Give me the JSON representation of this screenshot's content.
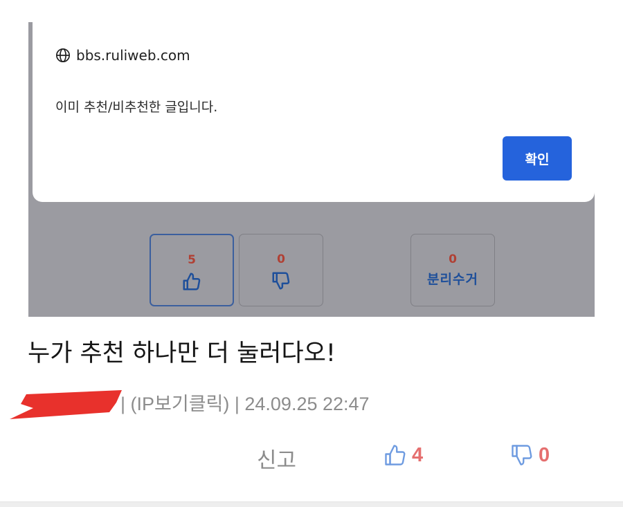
{
  "dialog": {
    "origin": "bbs.ruliweb.com",
    "message": "이미 추천/비추천한 글입니다.",
    "confirm_label": "확인"
  },
  "votes": {
    "upvote_count": "5",
    "downvote_count": "0",
    "recycle_count": "0",
    "recycle_label": "분리수거"
  },
  "post": {
    "title": "누가 추천 하나만 더 눌러다오!",
    "meta": "| (IP보기클릭) | 24.09.25 22:47"
  },
  "actions": {
    "report_label": "신고",
    "like_count": "4",
    "dislike_count": "0"
  },
  "colors": {
    "confirm_button": "#2563dc",
    "vote_count": "#b04034",
    "like_count": "#e56f6f",
    "redaction": "#e8312c"
  },
  "icons": [
    "globe-icon",
    "thumbs-up-icon",
    "thumbs-down-icon"
  ]
}
